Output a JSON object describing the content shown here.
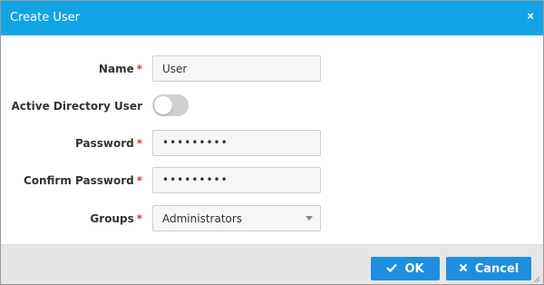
{
  "dialog": {
    "title": "Create User",
    "close_symbol": "×"
  },
  "form": {
    "name": {
      "label": "Name",
      "required_mark": "*",
      "value": "User"
    },
    "active_directory": {
      "label": "Active Directory User",
      "enabled": false
    },
    "password": {
      "label": "Password",
      "required_mark": "*",
      "value": "•••••••••"
    },
    "confirm_password": {
      "label": "Confirm Password",
      "required_mark": "*",
      "value": "•••••••••"
    },
    "groups": {
      "label": "Groups",
      "required_mark": "*",
      "selected": "Administrators"
    }
  },
  "footer": {
    "ok_label": "OK",
    "ok_icon": "check-icon",
    "cancel_label": "Cancel",
    "cancel_icon": "x-icon"
  },
  "colors": {
    "titlebar": "#12a4e4",
    "button": "#1e8fe0",
    "required": "#e0353a",
    "toggle_off": "#d0d0d0"
  }
}
